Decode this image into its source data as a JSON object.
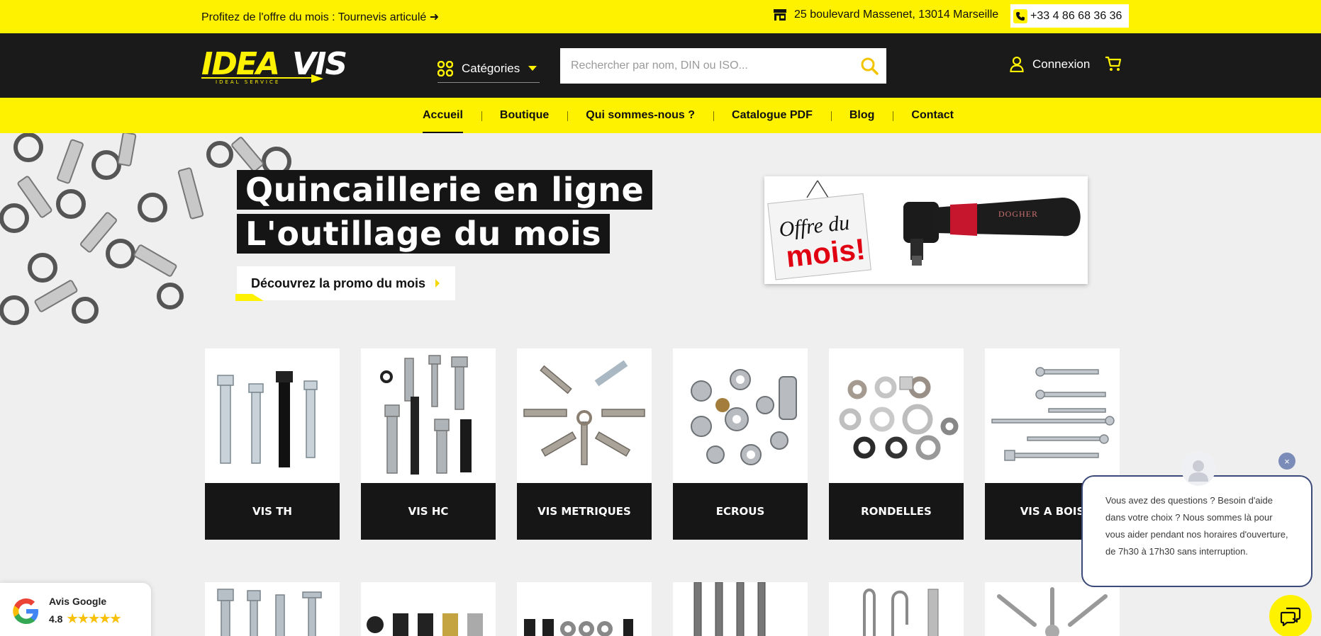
{
  "topbar": {
    "promo": "Profitez de l'offre du mois : Tournevis articulé ➜",
    "address": "25 boulevard Massenet, 13014 Marseille",
    "phone": "+33 4 86 68 36 36"
  },
  "header": {
    "logo_text": "IDEAVIS",
    "logo_tagline": "IDEAL SERVICE",
    "categories_label": "Catégories",
    "search_placeholder": "Rechercher par nom, DIN ou ISO...",
    "login_label": "Connexion"
  },
  "nav": {
    "items": [
      "Accueil",
      "Boutique",
      "Qui sommes-nous ?",
      "Catalogue PDF",
      "Blog",
      "Contact"
    ],
    "active": "Accueil"
  },
  "hero": {
    "line1": "Quincaillerie en ligne",
    "line2": "L'outillage du mois",
    "cta": "Découvrez la promo du mois",
    "promo_sign_line1": "Offre du",
    "promo_sign_line2": "mois!",
    "promo_brand": "DOGHER"
  },
  "categories": [
    "VIS TH",
    "VIS HC",
    "VIS METRIQUES",
    "ECROUS",
    "RONDELLES",
    "VIS A BOIS"
  ],
  "google": {
    "title": "Avis Google",
    "rating": "4.8",
    "stars": "★★★★★"
  },
  "chat": {
    "message": "Vous avez des questions ? Besoin d'aide dans votre choix ? Nous sommes là pour vous aider pendant nos horaires d'ouverture, de 7h30 à 17h30 sans interruption.",
    "close": "×"
  },
  "colors": {
    "brand_yellow": "#fff200",
    "header_dark": "#1a1a1a",
    "chat_border": "#3c4a7a"
  }
}
